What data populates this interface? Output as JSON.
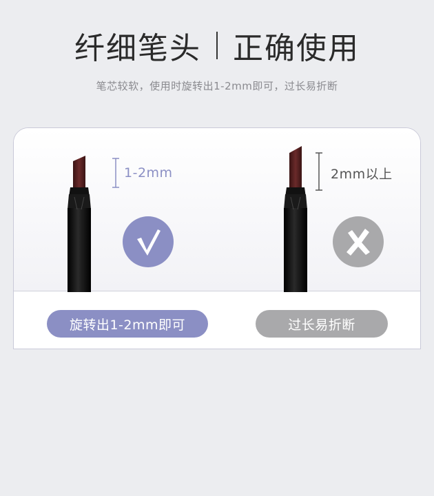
{
  "header": {
    "title_left": "纤细笔头",
    "title_right": "正确使用",
    "subtitle": "笔芯较软，使用时旋转出1-2mm即可，过长易折断"
  },
  "left_example": {
    "measure": "1-2mm",
    "icon": "check-icon",
    "caption": "旋转出1-2mm即可"
  },
  "right_example": {
    "measure": "2mm以上",
    "icon": "cross-icon",
    "caption": "过长易折断"
  },
  "colors": {
    "correct": "#8b8fc4",
    "wrong": "#a9a9ab",
    "lead": "#5b2424",
    "barrel": "#0d0d0d"
  }
}
